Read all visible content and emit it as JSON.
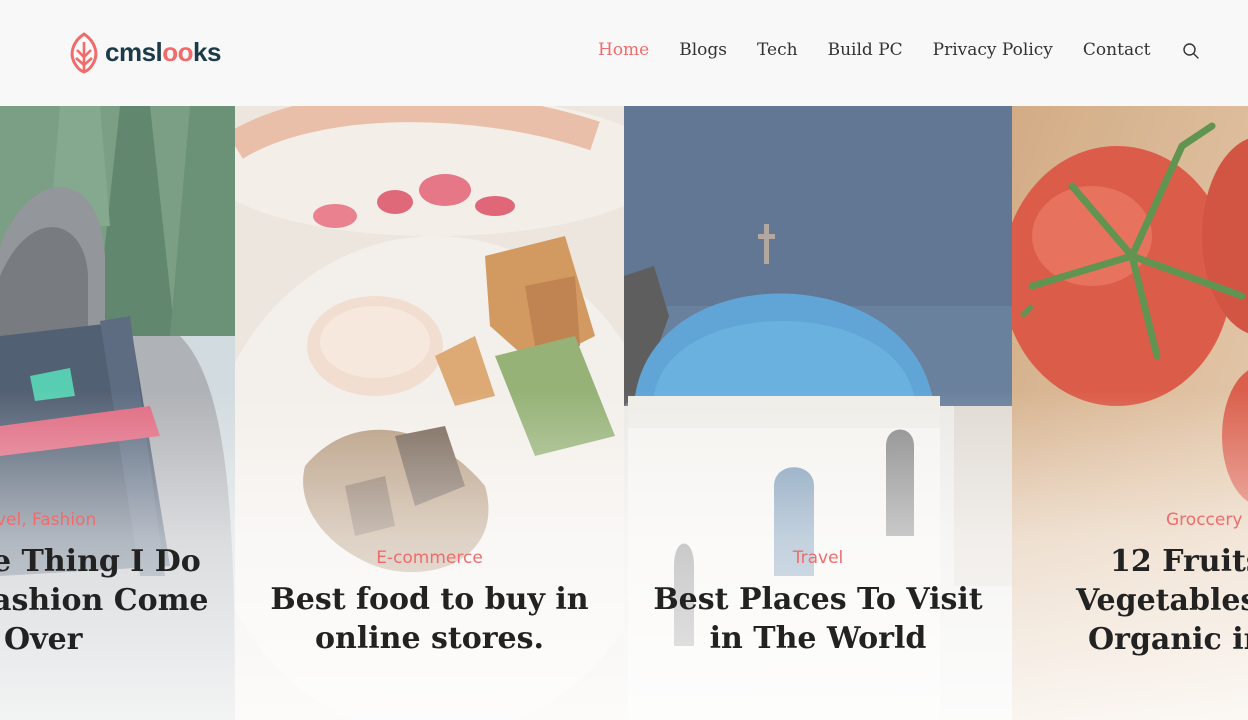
{
  "brand": {
    "name_pre": "cmsl",
    "name_oo": "oo",
    "name_post": "ks",
    "accent": "#f06c6c",
    "dark": "#1c3b4a"
  },
  "nav": {
    "items": [
      {
        "label": "Home",
        "active": true
      },
      {
        "label": "Blogs"
      },
      {
        "label": "Tech"
      },
      {
        "label": "Build PC"
      },
      {
        "label": "Privacy Policy"
      },
      {
        "label": "Contact"
      }
    ],
    "search_icon": "search-icon"
  },
  "cards": [
    {
      "categories": "vel, Fashion",
      "title_lines": [
        "e Thing I Do",
        "ashion Come",
        "Over"
      ]
    },
    {
      "categories": "E-commerce",
      "title_lines": [
        "Best food to buy in",
        "online stores."
      ]
    },
    {
      "categories": "Travel",
      "title_lines": [
        "Best Places To Visit",
        "in The World"
      ]
    },
    {
      "categories": "Groccery",
      "title_lines": [
        "12 Fruits",
        "Vegetables t",
        "Organic in"
      ]
    }
  ]
}
